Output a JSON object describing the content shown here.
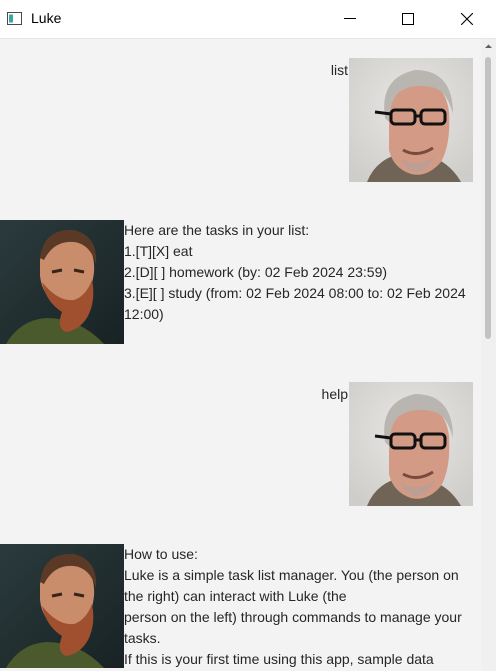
{
  "window": {
    "title": "Luke",
    "app_icon": "window-app-icon",
    "controls": [
      "minimize-icon",
      "maximize-icon",
      "close-icon"
    ]
  },
  "dialog": [
    {
      "speaker": "user",
      "avatar": "user-avatar",
      "text": "list"
    },
    {
      "speaker": "luke",
      "avatar": "luke-avatar",
      "text": "Here are the tasks in your list:\n1.[T][X] eat\n2.[D][ ] homework (by: 02 Feb 2024 23:59)\n3.[E][ ] study (from: 02 Feb 2024 08:00 to: 02 Feb 2024 12:00)"
    },
    {
      "speaker": "user",
      "avatar": "user-avatar",
      "text": "help"
    },
    {
      "speaker": "luke",
      "avatar": "luke-avatar",
      "text": "How to use:\nLuke is a simple task list manager. You (the person on the right) can interact with Luke (the\nperson on the left) through commands to manage your tasks.\nIf this is your first time using this app, sample data"
    }
  ]
}
